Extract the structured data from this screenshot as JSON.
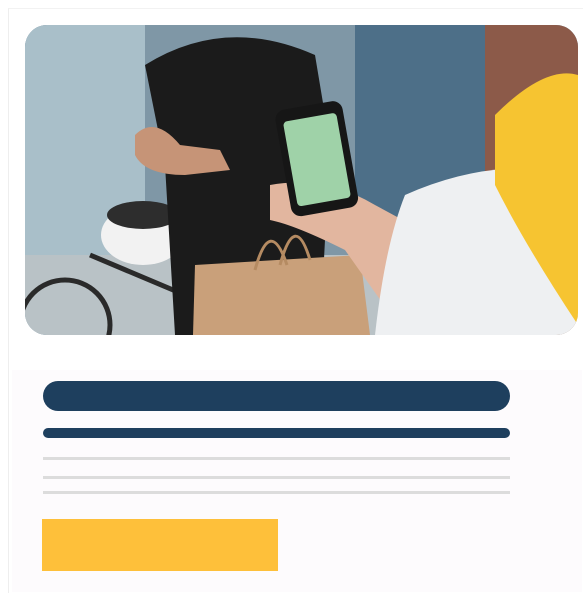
{
  "card": {
    "image": {
      "description_icon": "photo-image",
      "dominant_colors": [
        "#1b1b1b",
        "#c49a6c",
        "#f6c431",
        "#6e8798"
      ]
    },
    "skeleton": {
      "title_color": "#1e3f5e",
      "line_color": "#dcdcdc",
      "button_color": "#fec03a"
    }
  }
}
